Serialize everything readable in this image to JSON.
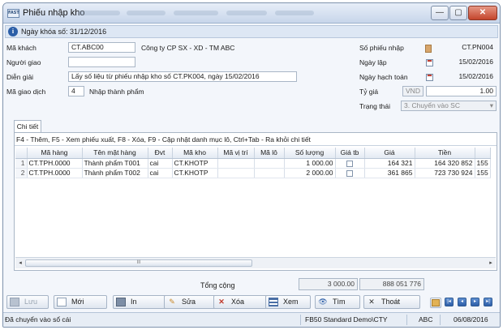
{
  "window": {
    "title": "Phiếu nhập kho",
    "app_icon_text": "FAST",
    "controls": {
      "minimize": "—",
      "maximize": "▢",
      "close": "✕"
    }
  },
  "doc_bar": {
    "text": "Ngày khóa số: 31/12/2016"
  },
  "form": {
    "ma_khach_label": "Mã khách",
    "ma_khach_value": "CT.ABC00",
    "ten_khach": "Công ty CP SX - XD - TM ABC",
    "nguoi_giao_label": "Người giao",
    "nguoi_giao_value": "",
    "dien_giai_label": "Diễn giải",
    "dien_giai_value": "Lấy số liệu từ phiếu nhập kho số CT.PK004, ngày 15/02/2016",
    "ma_giao_dich_label": "Mã giao dịch",
    "ma_giao_dich_value": "4",
    "ma_giao_dich_name": "Nhập thành phẩm",
    "so_phieu_label": "Số phiếu nhập",
    "so_phieu_value": "CT.PN004",
    "ngay_lap_label": "Ngày lập",
    "ngay_lap_value": "15/02/2016",
    "ngay_hach_toan_label": "Ngày hạch toán",
    "ngay_hach_toan_value": "15/02/2016",
    "ty_gia_label": "Tỷ giá",
    "ty_gia_currency": "VND",
    "ty_gia_value": "1.00",
    "trang_thai_label": "Trạng thái",
    "trang_thai_value": "3. Chuyển vào SC",
    "dropdown_arrow": "▾"
  },
  "tabs": [
    {
      "label": "Chi tiết"
    }
  ],
  "grid": {
    "hint": "F4 - Thêm, F5 - Xem phiếu xuất, F8 - Xóa, F9 - Cập nhật danh mục lô, Ctrl+Tab - Ra khỏi chi tiết",
    "columns": [
      "",
      "Mã hàng",
      "Tên mặt hàng",
      "Đvt",
      "Mã kho",
      "Mã vị trí",
      "Mã lô",
      "Số lượng",
      "Giá tb",
      "Giá",
      "Tiền",
      ""
    ],
    "rows": [
      {
        "idx": "1",
        "ma_hang": "CT.TPH.0000",
        "ten": "Thành phẩm T001",
        "dvt": "cai",
        "ma_kho": "CT.KHOTP",
        "vi_tri": "",
        "lo": "",
        "so_luong": "1 000.00",
        "gia_tb": false,
        "gia": "164 321",
        "tien": "164 320 852",
        "extra": "155"
      },
      {
        "idx": "2",
        "ma_hang": "CT.TPH.0000",
        "ten": "Thành phẩm T002",
        "dvt": "cai",
        "ma_kho": "CT.KHOTP",
        "vi_tri": "",
        "lo": "",
        "so_luong": "2 000.00",
        "gia_tb": false,
        "gia": "361 865",
        "tien": "723 730 924",
        "extra": "155"
      }
    ],
    "scroll": {
      "left": "◂",
      "right": "▸",
      "thumb": "III"
    }
  },
  "totals": {
    "label": "Tổng cộng",
    "so_luong": "3 000.00",
    "tien": "888 051 776"
  },
  "toolbar": {
    "save": "Lưu",
    "new": "Mới",
    "print": "In",
    "edit": "Sửa",
    "delete": "Xóa",
    "view": "Xem",
    "find": "Tìm",
    "exit": "Thoát",
    "nav": {
      "first": "|◂",
      "prev": "◂",
      "next": "▸",
      "last": "▸|"
    }
  },
  "status": {
    "message": "Đã chuyển vào sổ cái",
    "database": "FB50 Standard Demo\\CTY",
    "user": "ABC",
    "date": "06/08/2016"
  },
  "colors": {
    "titlebar": "#c7d6ea",
    "close_button": "#c4452c",
    "accent": "#2d5ea8"
  }
}
